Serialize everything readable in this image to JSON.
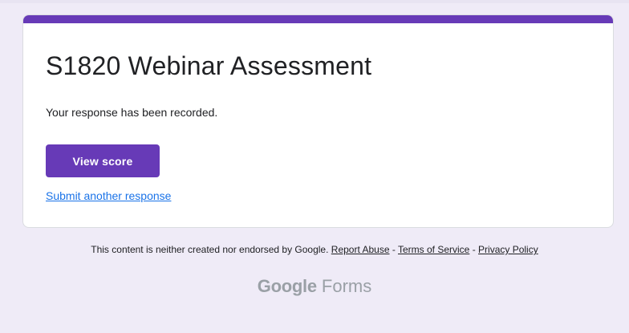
{
  "form": {
    "title": "S1820 Webinar Assessment",
    "confirmation": "Your response has been recorded.",
    "view_score_label": "View score",
    "submit_another_label": "Submit another response"
  },
  "footer": {
    "disclaimer": "This content is neither created nor endorsed by Google.",
    "report_abuse": "Report Abuse",
    "separator": "-",
    "terms": "Terms of Service",
    "privacy": "Privacy Policy"
  },
  "brand": {
    "google": "Google",
    "forms": "Forms"
  },
  "colors": {
    "accent": "#673ab7",
    "background": "#efebf7",
    "link": "#1a73e8"
  }
}
